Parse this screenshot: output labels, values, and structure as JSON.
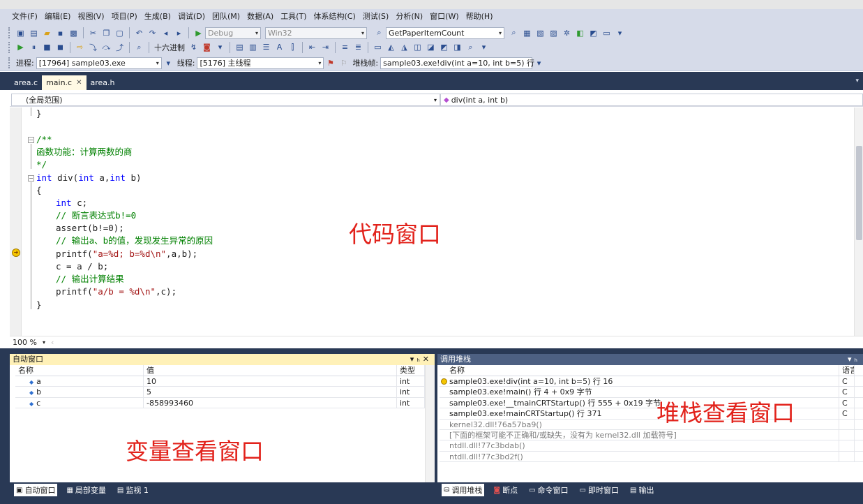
{
  "menu": [
    "文件(F)",
    "编辑(E)",
    "视图(V)",
    "项目(P)",
    "生成(B)",
    "调试(D)",
    "团队(M)",
    "数据(A)",
    "工具(T)",
    "体系结构(C)",
    "测试(S)",
    "分析(N)",
    "窗口(W)",
    "帮助(H)"
  ],
  "toolbar1": {
    "config": "Debug",
    "platform": "Win32",
    "find_value": "GetPaperItemCount"
  },
  "toolbar2": {
    "hex_label": "十六进制"
  },
  "toolbar3": {
    "process_label": "进程:",
    "process_value": "[17964] sample03.exe",
    "thread_label": "线程:",
    "thread_value": "[5176] 主线程",
    "stack_label": "堆栈帧:",
    "stack_value": "sample03.exe!div(int a=10, int b=5) 行"
  },
  "doc_tabs": [
    "area.c",
    "main.c",
    "area.h"
  ],
  "nav": {
    "scope": "(全局范围)",
    "member": "div(int a, int b)"
  },
  "code": {
    "line_close": "}",
    "doc_open": "/**",
    "doc_text": "函数功能：计算两数的商",
    "doc_close": "*/",
    "sig_kw1": "int",
    "sig_mid": " div(",
    "sig_kw2": "int",
    "sig_a": " a,",
    "sig_kw3": "int",
    "sig_end": " b)",
    "brace_open": "{",
    "decl_kw": "int",
    "decl_rest": " c;",
    "c1": "// 断言表达式b!=0",
    "assert_line": "assert(b!=0);",
    "c2": "// 输出a、b的值，发现发生异常的原因",
    "printf1_a": "printf(",
    "printf1_s": "\"a=%d; b=%d\\n\"",
    "printf1_b": ",a,b);",
    "calc_line": "c = a / b;",
    "c3": "// 输出计算结果",
    "printf2_a": "printf(",
    "printf2_s": "\"a/b = %d\\n\"",
    "printf2_b": ",c);",
    "brace_close": "}"
  },
  "labels": {
    "code_window": "代码窗口",
    "var_window": "变量查看窗口",
    "stack_window": "堆栈查看窗口"
  },
  "zoom": "100 %",
  "autos": {
    "title": "自动窗口",
    "headers": [
      "名称",
      "值",
      "类型"
    ],
    "rows": [
      {
        "name": "a",
        "value": "10",
        "type": "int"
      },
      {
        "name": "b",
        "value": "5",
        "type": "int"
      },
      {
        "name": "c",
        "value": "-858993460",
        "type": "int"
      }
    ],
    "tabs": [
      "自动窗口",
      "局部变量",
      "监视 1"
    ]
  },
  "callstack": {
    "title": "调用堆栈",
    "headers": [
      "名称",
      "语言"
    ],
    "rows": [
      {
        "name": "sample03.exe!div(int a=10, int b=5)  行 16",
        "lang": "C"
      },
      {
        "name": "sample03.exe!main()  行 4 + 0x9 字节",
        "lang": "C"
      },
      {
        "name": "sample03.exe!__tmainCRTStartup()  行 555 + 0x19 字节",
        "lang": "C"
      },
      {
        "name": "sample03.exe!mainCRTStartup()  行 371",
        "lang": "C"
      },
      {
        "name": "kernel32.dll!76a57ba9()",
        "lang": ""
      },
      {
        "name": "[下面的框架可能不正确和/或缺失，没有为 kernel32.dll 加载符号]",
        "lang": ""
      },
      {
        "name": "ntdll.dll!77c3bdab()",
        "lang": ""
      },
      {
        "name": "ntdll.dll!77c3bd2f()",
        "lang": ""
      }
    ],
    "tabs": [
      "调用堆栈",
      "断点",
      "命令窗口",
      "即时窗口",
      "输出"
    ]
  }
}
